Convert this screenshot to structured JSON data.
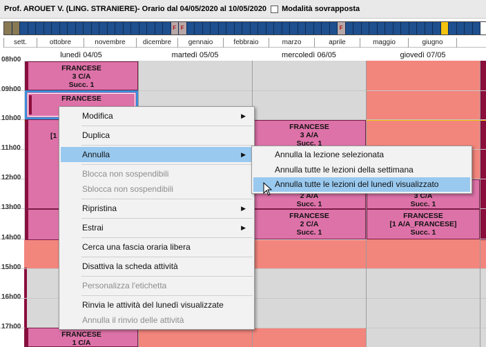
{
  "title": {
    "teacher": "Prof. AROUET V. (LING. STRANIERE)",
    "range": " - Orario dal 04/05/2020 al 10/05/2020",
    "overlay_label": "Modalità sovrapposta"
  },
  "holiday_marker": "F",
  "months": [
    "sett.",
    "ottobre",
    "novembre",
    "dicembre",
    "gennaio",
    "febbraio",
    "marzo",
    "aprile",
    "maggio",
    "giugno"
  ],
  "days": [
    "lunedì 04/05",
    "martedì 05/05",
    "mercoledì 06/05",
    "giovedì 07/05"
  ],
  "hours": [
    "08h00",
    "09h00",
    "10h00",
    "11h00",
    "12h00",
    "13h00",
    "14h00",
    "15h00",
    "16h00",
    "17h00"
  ],
  "lessons": {
    "mon_0800": {
      "subject": "FRANCESE",
      "class": "3 C/A",
      "note": "Succ. 1"
    },
    "mon_0900": {
      "subject": "FRANCESE"
    },
    "mon_1000_partial": "[1",
    "mon_1700": {
      "subject": "FRANCESE",
      "class": "1 C/A"
    },
    "wed_1000": {
      "subject": "FRANCESE",
      "class": "3 A/A",
      "note": "Succ. 1"
    },
    "wed_1200": {
      "class": "2 A/A",
      "note": "Succ. 1"
    },
    "wed_1300": {
      "subject": "FRANCESE",
      "class": "2 C/A",
      "note": "Succ. 1"
    },
    "thu_1200": {
      "class": "3 C/A",
      "note": "Succ. 1"
    },
    "thu_1300": {
      "subject": "FRANCESE",
      "class": "[1 A/A_FRANCESE]",
      "note": "Succ. 1"
    }
  },
  "context_menu": {
    "modifica": "Modifica",
    "duplica": "Duplica",
    "annulla": "Annulla",
    "blocca": "Blocca non sospendibili",
    "sblocca": "Sblocca non sospendibili",
    "ripristina": "Ripristina",
    "estrai": "Estrai",
    "cerca": "Cerca una fascia oraria libera",
    "disattiva": "Disattiva la scheda attività",
    "personalizza": "Personalizza l'etichetta",
    "rinvia": "Rinvia le attività del lunedì visualizzate",
    "annulla_rinvio": "Annulla il rinvio delle attività"
  },
  "submenu": {
    "item1": "Annulla la lezione selezionata",
    "item2": "Annulla tutte le lezioni della settimana",
    "item3": "Annulla tutte le lezioni del lunedì visualizzato"
  },
  "colors": {
    "lesson": "#dd72a8",
    "lesson_bar": "#8a0e3c",
    "free": "#f2857c",
    "highlight": "#99c9ef",
    "week_blue": "#1e4f8e",
    "week_current": "#f4c30e"
  }
}
